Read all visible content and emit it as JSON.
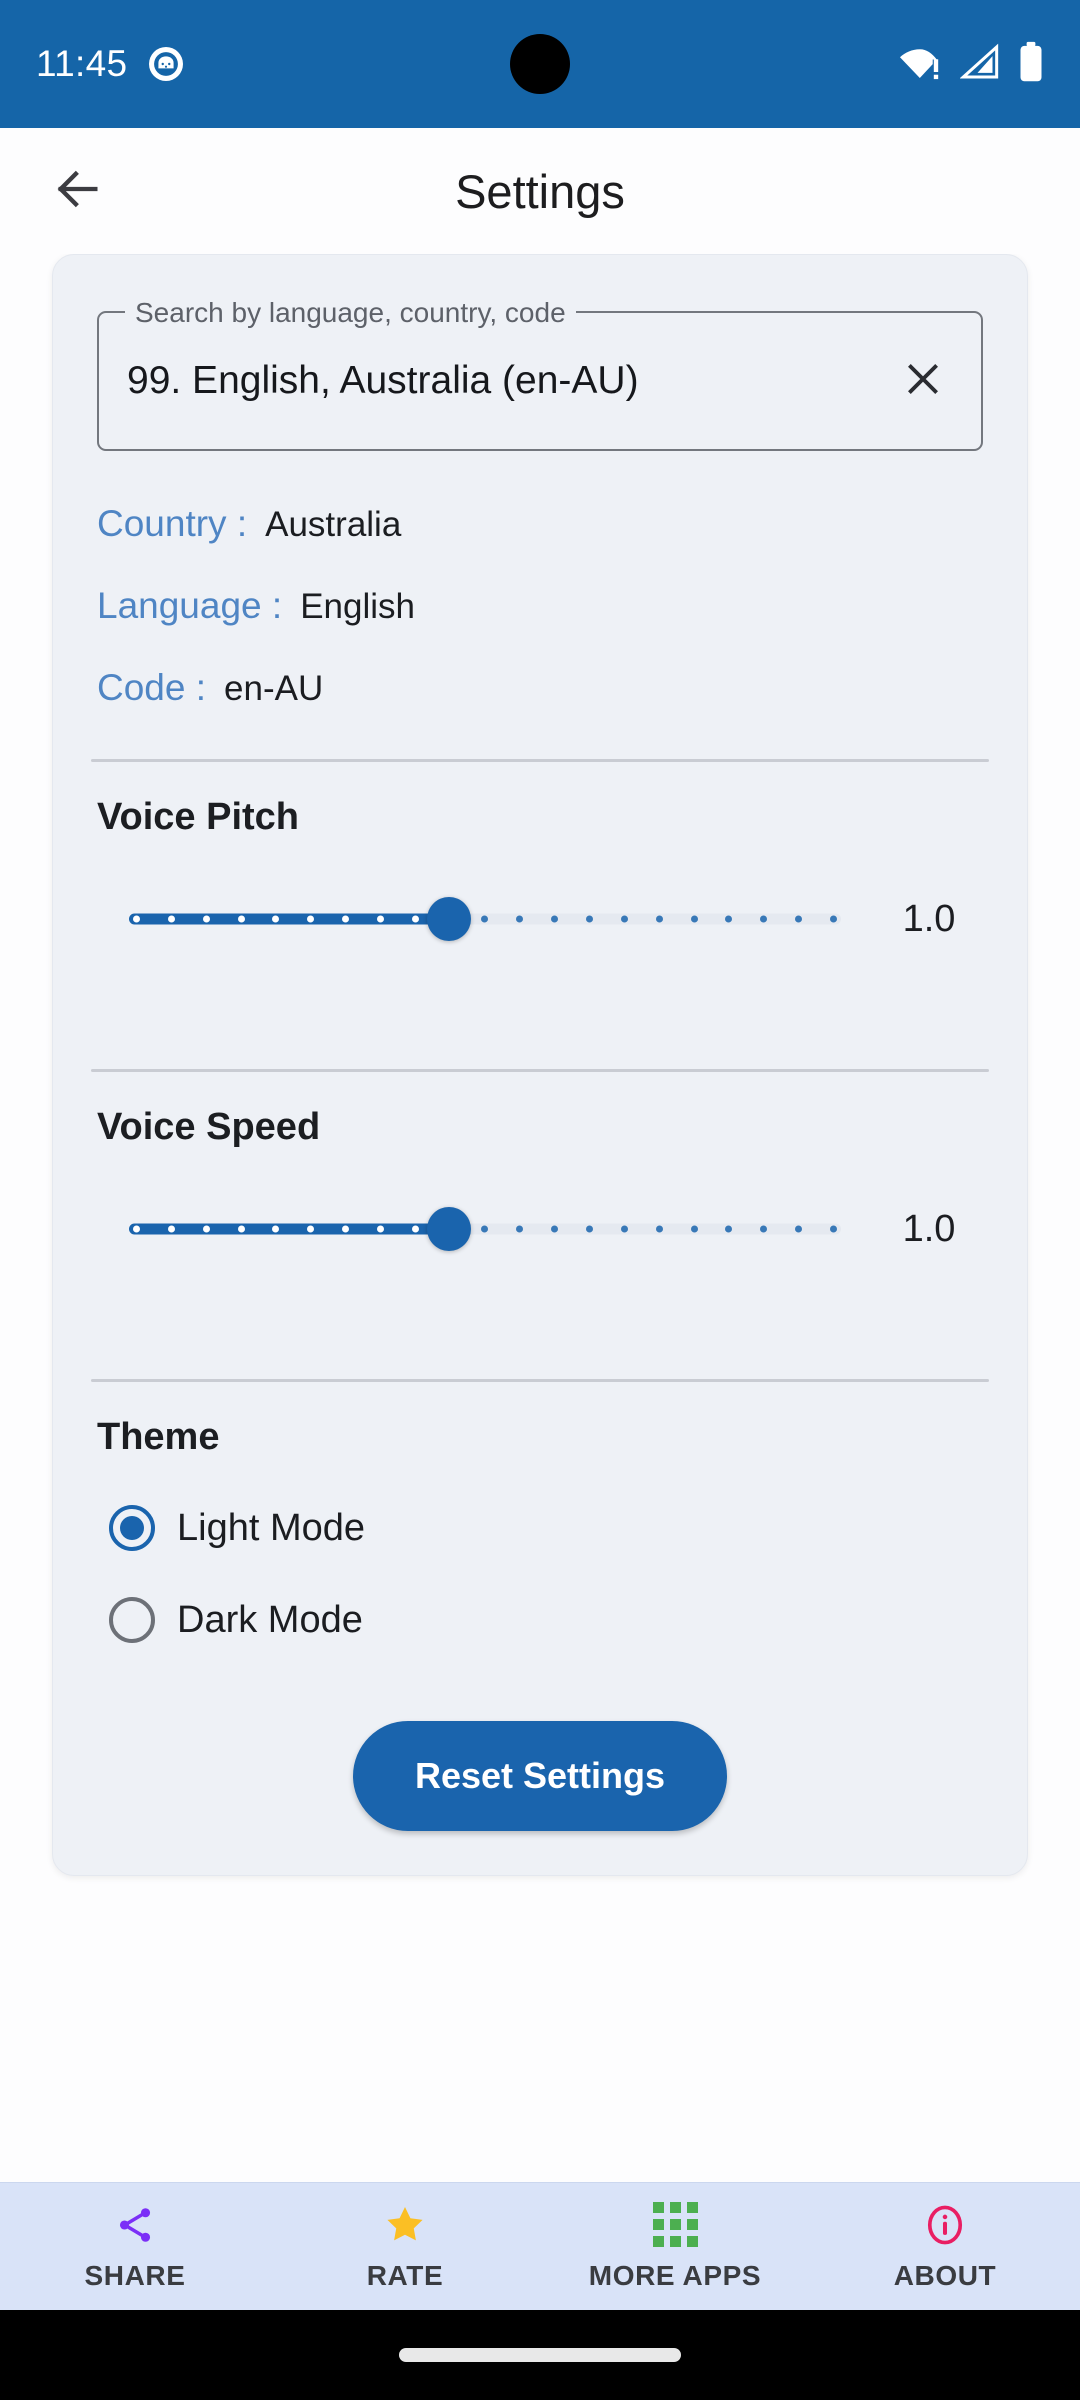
{
  "status_bar": {
    "time": "11:45",
    "app_notification_icon": "app-notification-icon",
    "wifi_icon": "wifi-warning-icon",
    "signal_icon": "cellular-signal-icon",
    "battery_icon": "battery-full-icon",
    "background_color": "#1565a8"
  },
  "app_bar": {
    "back_icon": "back-arrow-icon",
    "title": "Settings"
  },
  "search_field": {
    "label": "Search by language, country, code",
    "value": "99. English, Australia (en-AU)",
    "placeholder": "Search by language, country, code",
    "clear_icon": "close-icon"
  },
  "info": {
    "rows": [
      {
        "label": "Country :",
        "value": "Australia"
      },
      {
        "label": "Language :",
        "value": "English"
      },
      {
        "label": "Code :",
        "value": "en-AU"
      }
    ],
    "label_color": "#4f85c4"
  },
  "voice_pitch": {
    "title": "Voice Pitch",
    "value": "1.0",
    "fill_percent": 45,
    "tick_count": 21,
    "accent_color": "#1a64ad"
  },
  "voice_speed": {
    "title": "Voice Speed",
    "value": "1.0",
    "fill_percent": 45,
    "tick_count": 21,
    "accent_color": "#1a64ad"
  },
  "theme": {
    "title": "Theme",
    "options": [
      {
        "label": "Light Mode",
        "selected": true
      },
      {
        "label": "Dark Mode",
        "selected": false
      }
    ]
  },
  "reset": {
    "label": "Reset Settings",
    "color": "#1a64ad"
  },
  "bottom_nav": {
    "items": [
      {
        "label": "SHARE",
        "icon": "share-icon",
        "color": "#7b2ff7"
      },
      {
        "label": "RATE",
        "icon": "star-icon",
        "color": "#fbbf24"
      },
      {
        "label": "MORE APPS",
        "icon": "grid-apps-icon",
        "color": "#4caf50"
      },
      {
        "label": "ABOUT",
        "icon": "info-circle-icon",
        "color": "#e91e63"
      }
    ],
    "background_color": "#d9e3f8"
  },
  "card": {
    "background_color": "#eef1f6"
  }
}
